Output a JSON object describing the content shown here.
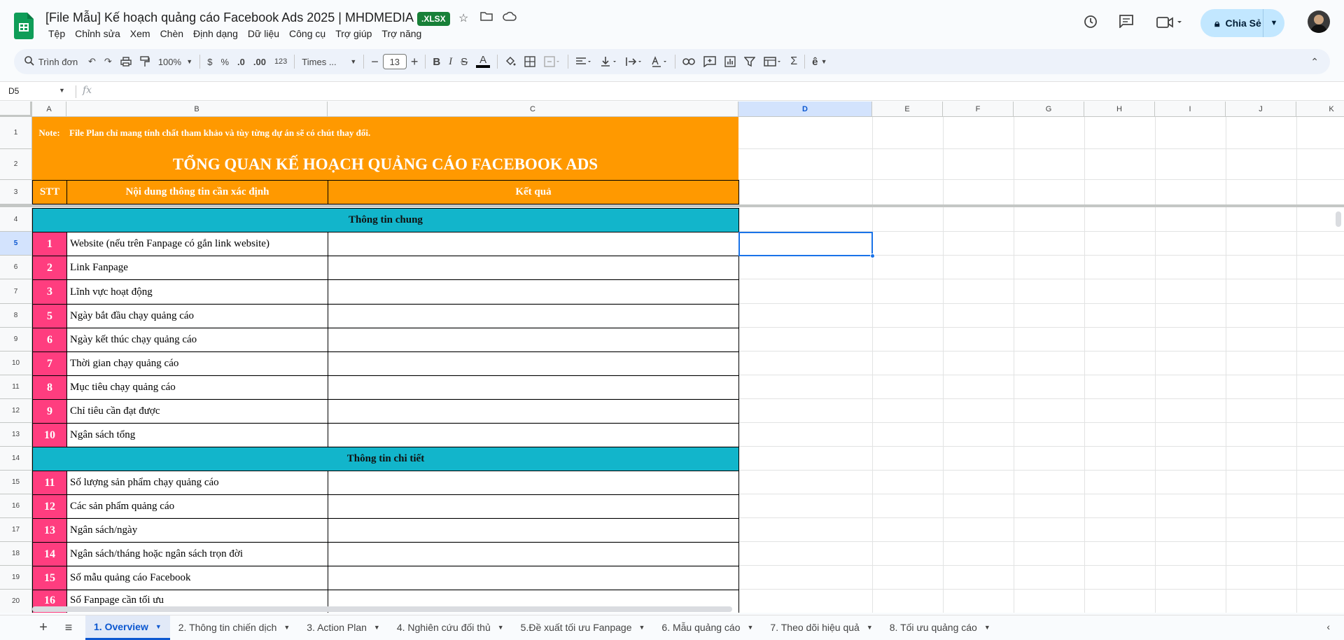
{
  "app": {
    "title": "[File Mẫu] Kế hoạch quảng cáo Facebook Ads 2025 | MHDMEDIA",
    "badge": ".XLSX",
    "share_label": "Chia Sẻ"
  },
  "menu": [
    "Tệp",
    "Chỉnh sửa",
    "Xem",
    "Chèn",
    "Định dạng",
    "Dữ liệu",
    "Công cụ",
    "Trợ giúp",
    "Trợ năng"
  ],
  "toolbar": {
    "search_label": "Trình đơn",
    "zoom": "100%",
    "currency": "$",
    "percent": "%",
    "dec_less": ".0",
    "dec_more": ".00",
    "number_format": "123",
    "font": "Times ...",
    "font_size": "13"
  },
  "formula": {
    "namebox": "D5",
    "fx": "fx"
  },
  "columns": [
    "A",
    "B",
    "C",
    "D",
    "E",
    "F",
    "G",
    "H",
    "I",
    "J",
    "K"
  ],
  "rows": [
    "1",
    "2",
    "3",
    "4",
    "5",
    "6",
    "7",
    "8",
    "9",
    "10",
    "11",
    "12",
    "13",
    "14",
    "15",
    "16",
    "17",
    "18",
    "19",
    "20"
  ],
  "sheet": {
    "note_label": "Note:",
    "note_text": "File Plan chỉ mang tính chất tham khảo và tùy từng dự án sẽ có chút thay đổi.",
    "main_title": "TỔNG QUAN KẾ HOẠCH QUẢNG CÁO FACEBOOK ADS",
    "hdr_stt": "STT",
    "hdr_content": "Nội dung thông tin cần xác định",
    "hdr_result": "Kết quả",
    "section1": "Thông tin chung",
    "section2": "Thông tin chi tiết",
    "items": [
      {
        "no": "1",
        "text": "Website (nếu trên Fanpage có gắn link website)"
      },
      {
        "no": "2",
        "text": "Link Fanpage"
      },
      {
        "no": "3",
        "text": "Lĩnh vực hoạt động"
      },
      {
        "no": "5",
        "text": "Ngày bắt đầu chạy quảng cáo"
      },
      {
        "no": "6",
        "text": "Ngày kết thúc chạy quảng cáo"
      },
      {
        "no": "7",
        "text": "Thời gian chạy quảng cáo"
      },
      {
        "no": "8",
        "text": "Mục tiêu chạy quảng cáo"
      },
      {
        "no": "9",
        "text": "Chỉ tiêu cần đạt được"
      },
      {
        "no": "10",
        "text": "Ngân sách tổng"
      },
      {
        "no": "11",
        "text": "Số lượng sản phẩm chạy quảng cáo"
      },
      {
        "no": "12",
        "text": "Các sản phẩm quảng cáo"
      },
      {
        "no": "13",
        "text": "Ngân sách/ngày"
      },
      {
        "no": "14",
        "text": "Ngân sách/tháng hoặc ngân sách trọn đời"
      },
      {
        "no": "15",
        "text": "Số mẫu quảng cáo Facebook"
      },
      {
        "no": "16",
        "text": "Số Fanpage cần tối ưu"
      }
    ]
  },
  "tabs": [
    "1. Overview",
    "2. Thông tin chiến dịch",
    "3. Action Plan",
    "4. Nghiên cứu đối thủ",
    "5.Đề xuất tối ưu Fanpage",
    "6. Mẫu quảng cáo",
    "7. Theo dõi hiệu quả",
    "8. Tối ưu quảng cáo"
  ],
  "colors": {
    "orange": "#ff9900",
    "teal": "#12b5cb",
    "pink": "#ff3d7f",
    "accent": "#1a73e8"
  }
}
